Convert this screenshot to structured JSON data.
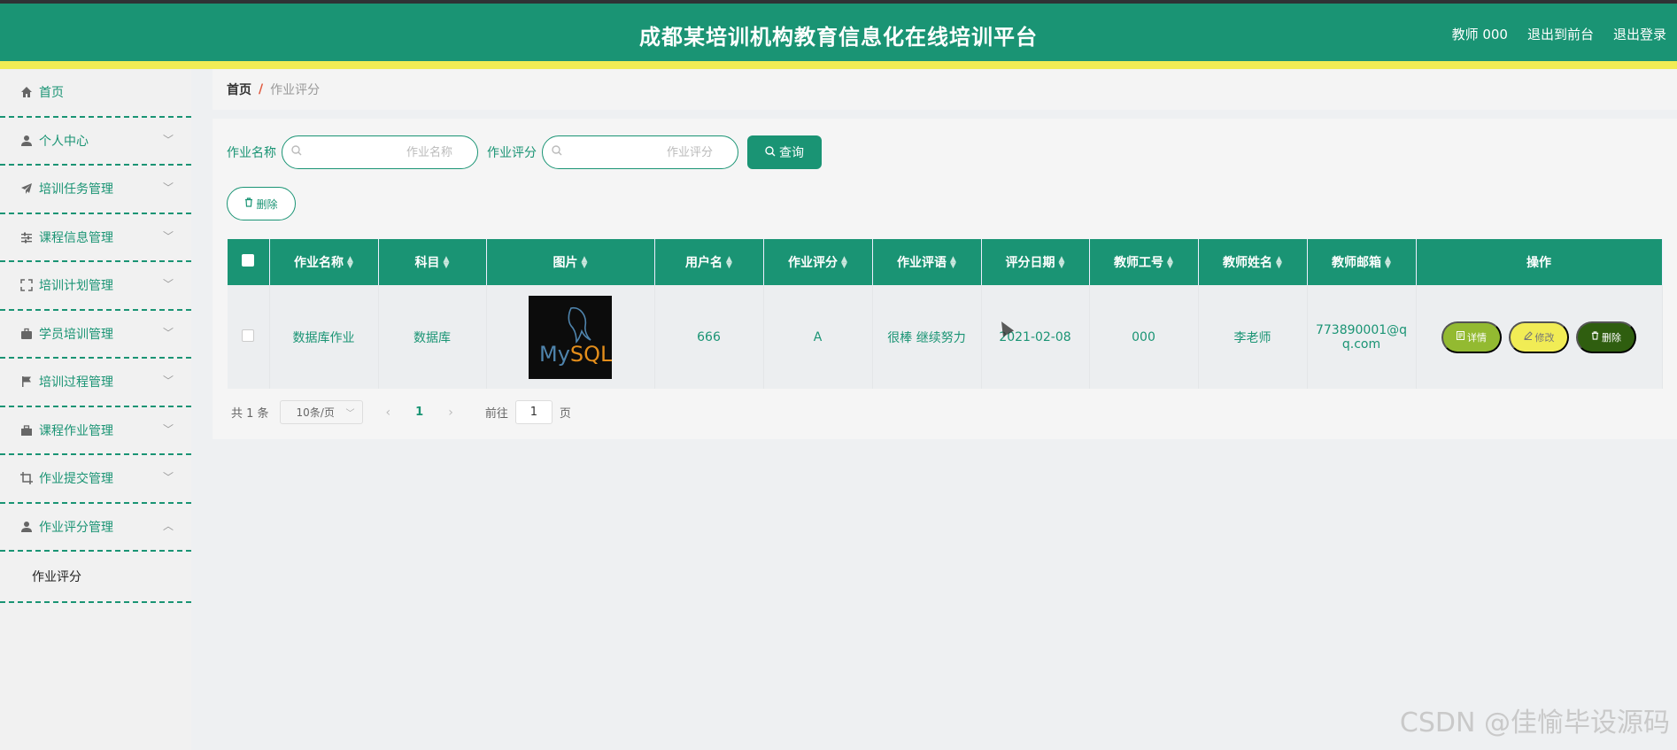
{
  "header": {
    "title": "成都某培训机构教育信息化在线培训平台",
    "user": "教师 000",
    "to_front": "退出到前台",
    "logout": "退出登录"
  },
  "sidebar": {
    "items": [
      {
        "label": "首页",
        "icon": "home-icon"
      },
      {
        "label": "个人中心",
        "icon": "user-icon"
      },
      {
        "label": "培训任务管理",
        "icon": "paper-plane-icon"
      },
      {
        "label": "课程信息管理",
        "icon": "sliders-icon"
      },
      {
        "label": "培训计划管理",
        "icon": "fullscreen-icon"
      },
      {
        "label": "学员培训管理",
        "icon": "briefcase-icon"
      },
      {
        "label": "培训过程管理",
        "icon": "flag-icon"
      },
      {
        "label": "课程作业管理",
        "icon": "toolbox-icon"
      },
      {
        "label": "作业提交管理",
        "icon": "crop-icon"
      },
      {
        "label": "作业评分管理",
        "icon": "user-icon"
      }
    ],
    "sub_item": "作业评分"
  },
  "breadcrumb": {
    "home": "首页",
    "sep": "/",
    "current": "作业评分"
  },
  "search": {
    "name_label": "作业名称",
    "name_placeholder": "作业名称",
    "score_label": "作业评分",
    "score_placeholder": "作业评分",
    "query_label": "查询"
  },
  "toolbar": {
    "delete_label": "删除"
  },
  "table": {
    "headers": [
      "作业名称",
      "科目",
      "图片",
      "用户名",
      "作业评分",
      "作业评语",
      "评分日期",
      "教师工号",
      "教师姓名",
      "教师邮箱",
      "操作"
    ],
    "rows": [
      {
        "name": "数据库作业",
        "subject": "数据库",
        "image_text_1": "My",
        "image_text_2": "SQL",
        "username": "666",
        "score": "A",
        "comment": "很棒 继续努力",
        "date": "2021-02-08",
        "teacher_id": "000",
        "teacher_name": "李老师",
        "teacher_email_1": "773890001@q",
        "teacher_email_2": "q.com",
        "detail": "详情",
        "edit": "修改",
        "delete": "删除"
      }
    ]
  },
  "pager": {
    "total": "共 1 条",
    "page_size": "10条/页",
    "current": "1",
    "goto_prefix": "前往",
    "goto_value": "1",
    "goto_suffix": "页"
  },
  "watermark": "CSDN @佳愉毕设源码",
  "colors": {
    "primary": "#1a9474",
    "accent_yellow": "#f1ec55",
    "detail_green": "#93ba31",
    "delete_dark": "#2f5e0f"
  }
}
